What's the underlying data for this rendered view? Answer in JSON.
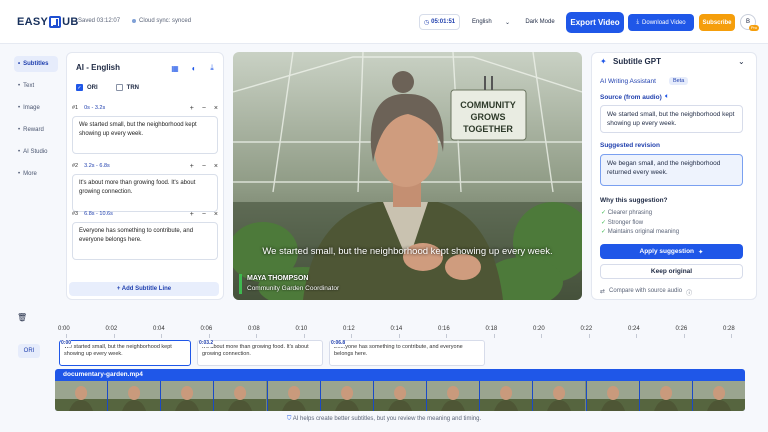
{
  "header": {
    "logo_left": "EASY",
    "logo_right": "UB",
    "saved": "Saved 03:12:07",
    "sync": "Cloud sync: synced",
    "timer": "05:01:51",
    "language": "English",
    "dark_mode": "Dark Mode",
    "export": "Export Video",
    "download": "Download Video",
    "subscribe": "Subscribe",
    "avatar": "B",
    "pro": "Pro"
  },
  "sidebar": {
    "items": [
      {
        "label": "Subtitles"
      },
      {
        "label": "Text"
      },
      {
        "label": "Image"
      },
      {
        "label": "Reward"
      },
      {
        "label": "AI Studio"
      },
      {
        "label": "More"
      }
    ]
  },
  "subtitles_panel": {
    "title": "AI - English",
    "ori": "ORI",
    "trn": "TRN",
    "add_line": "+ Add Subtitle Line",
    "segments": [
      {
        "num": "#1",
        "time": "0s - 3.2s",
        "text": "We started small, but the neighborhood kept showing up every week."
      },
      {
        "num": "#2",
        "time": "3.2s - 6.8s",
        "text": "It's about more than growing food. It's about growing connection."
      },
      {
        "num": "#3",
        "time": "6.8s - 10.6s",
        "text": "Everyone has something to contribute, and everyone belongs here."
      }
    ]
  },
  "video": {
    "sign_lines": [
      "COMMUNITY",
      "GROWS",
      "TOGETHER"
    ],
    "caption": "We started small, but the neighborhood kept showing up every week.",
    "name": "MAYA THOMPSON",
    "role": "Community Garden Coordinator"
  },
  "gpt": {
    "title": "Subtitle GPT",
    "assistant": "AI Writing Assistant",
    "beta": "Beta",
    "source_label": "Source (from audio)",
    "source_text": "We started small, but the neighborhood kept showing up every week.",
    "suggest_label": "Suggested revision",
    "suggest_text": "We began small, and the neighborhood returned every week.",
    "why": "Why this suggestion?",
    "reasons": [
      "Clearer phrasing",
      "Stronger flow",
      "Maintains original meaning"
    ],
    "apply": "Apply suggestion",
    "keep": "Keep original",
    "compare": "Compare with source audio"
  },
  "timeline": {
    "ticks": [
      "0:00",
      "0:02",
      "0:04",
      "0:06",
      "0:08",
      "0:10",
      "0:12",
      "0:14",
      "0:16",
      "0:18",
      "0:20",
      "0:22",
      "0:24",
      "0:26",
      "0:28",
      "0:30"
    ],
    "track_label": "ORI",
    "cues": [
      {
        "start": "0:00",
        "text": "We started small, but the neighborhood kept showing up every week."
      },
      {
        "start": "0:03.2",
        "text": "It's about more than growing food. It's about growing connection."
      },
      {
        "start": "0:06.8",
        "text": "Everyone has something to contribute, and everyone belongs here."
      }
    ],
    "video_file": "documentary-garden.mp4"
  },
  "footer": "AI helps create better subtitles, but you review the meaning and timing.",
  "colors": {
    "accent": "#1f57e8",
    "subscribe": "#f59e0b"
  }
}
